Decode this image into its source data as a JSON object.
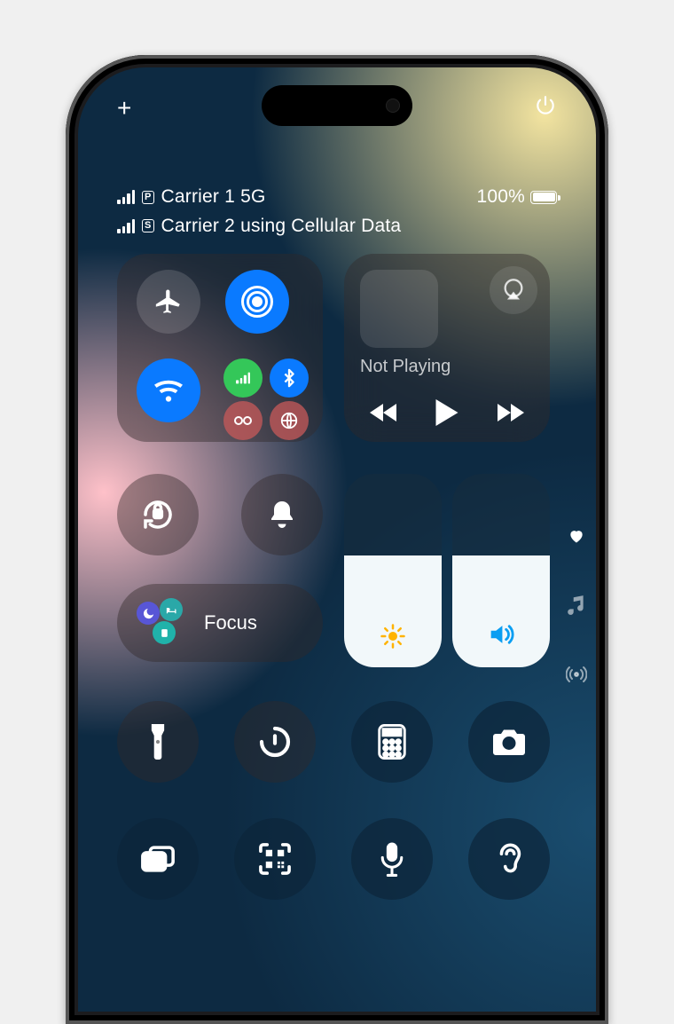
{
  "topbar": {
    "add": "+",
    "power": "power"
  },
  "status": {
    "line1": {
      "sim": "P",
      "carrier": "Carrier 1 5G"
    },
    "line2": {
      "sim": "S",
      "carrier": "Carrier 2 using Cellular Data"
    },
    "battery_pct": "100%"
  },
  "connectivity": {
    "airplane": "airplane-icon",
    "airdrop": "airdrop-icon",
    "wifi": "wifi-icon",
    "cellular": "cellular-icon",
    "bluetooth": "bluetooth-icon",
    "hotspot": "hotspot-icon",
    "vpn": "satellite-icon"
  },
  "media": {
    "now_playing": "Not Playing"
  },
  "toggles": {
    "orientation_lock": "orientation-lock-icon",
    "silent": "bell-icon"
  },
  "focus": {
    "label": "Focus"
  },
  "sliders": {
    "brightness": {
      "level": 0.58,
      "icon": "sun-icon",
      "color": "#ffb300"
    },
    "volume": {
      "level": 0.58,
      "icon": "speaker-icon",
      "color": "#0a9ef2"
    }
  },
  "shortcuts_row1": [
    "flashlight",
    "timer",
    "calculator",
    "camera"
  ],
  "shortcuts_row2": [
    "screen-mirroring",
    "qr-scanner",
    "microphone",
    "hearing"
  ],
  "side_nav": [
    "favorites-heart-icon",
    "music-note-icon",
    "radio-waves-icon"
  ]
}
